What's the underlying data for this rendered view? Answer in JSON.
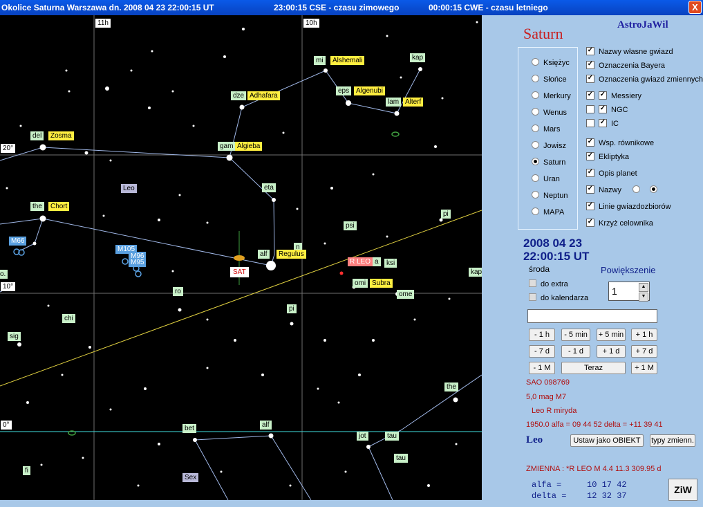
{
  "titlebar": {
    "part1": "Okolice Saturna  Warszawa dn. 2008 04 23    22:00:15 UT",
    "part2": "23:00:15 CSE - czasu zimowego",
    "part3": "00:00:15 CWE - czasu letniego",
    "close": "X"
  },
  "map": {
    "hour_labels": [
      "11h",
      "10h"
    ],
    "dec_labels": [
      "20°",
      "10°",
      "0°"
    ],
    "stars": [
      {
        "text": "mi",
        "style": "g"
      },
      {
        "text": "Alshemali",
        "style": "y"
      },
      {
        "text": "kap",
        "style": "g"
      },
      {
        "text": "dze",
        "style": "g"
      },
      {
        "text": "Adhafara",
        "style": "y"
      },
      {
        "text": "eps",
        "style": "g"
      },
      {
        "text": "Algenubi",
        "style": "y"
      },
      {
        "text": "lam",
        "style": "g"
      },
      {
        "text": "Alterf",
        "style": "y"
      },
      {
        "text": "del",
        "style": "g"
      },
      {
        "text": "Zosma",
        "style": "y"
      },
      {
        "text": "gam",
        "style": "g"
      },
      {
        "text": "Algieba",
        "style": "y"
      },
      {
        "text": "Leo",
        "style": "p"
      },
      {
        "text": "eta",
        "style": "g"
      },
      {
        "text": "the",
        "style": "g"
      },
      {
        "text": "Chort",
        "style": "y"
      },
      {
        "text": "pi",
        "style": "g"
      },
      {
        "text": "psi",
        "style": "g"
      },
      {
        "text": "M66",
        "style": "b"
      },
      {
        "text": "M105",
        "style": "b"
      },
      {
        "text": "M96",
        "style": "b"
      },
      {
        "text": "M95",
        "style": "b"
      },
      {
        "text": "n",
        "style": "g"
      },
      {
        "text": "alf",
        "style": "g"
      },
      {
        "text": "Regulus",
        "style": "y"
      },
      {
        "text": "SAT",
        "style": "sat"
      },
      {
        "text": "R LEO",
        "style": "r"
      },
      {
        "text": "a",
        "style": "g"
      },
      {
        "text": "ksi",
        "style": "g"
      },
      {
        "text": "kap",
        "style": "g"
      },
      {
        "text": "o.",
        "style": "g"
      },
      {
        "text": "ro",
        "style": "g"
      },
      {
        "text": "omi",
        "style": "g"
      },
      {
        "text": "Subra",
        "style": "y"
      },
      {
        "text": "ome",
        "style": "g"
      },
      {
        "text": "pi",
        "style": "g"
      },
      {
        "text": "chi",
        "style": "g"
      },
      {
        "text": "sig",
        "style": "g"
      },
      {
        "text": "the",
        "style": "g"
      },
      {
        "text": "bet",
        "style": "g"
      },
      {
        "text": "alf",
        "style": "g"
      },
      {
        "text": "jot",
        "style": "g"
      },
      {
        "text": "tau",
        "style": "g"
      },
      {
        "text": "tau",
        "style": "g"
      },
      {
        "text": "fi",
        "style": "g"
      },
      {
        "text": "Sex",
        "style": "p"
      }
    ]
  },
  "panel": {
    "planet_name": "Saturn",
    "brand": "AstroJaWil",
    "planets": [
      {
        "label": "Księżyc",
        "selected": false
      },
      {
        "label": "Słońce",
        "selected": false
      },
      {
        "label": "Merkury",
        "selected": false
      },
      {
        "label": "Wenus",
        "selected": false
      },
      {
        "label": "Mars",
        "selected": false
      },
      {
        "label": "Jowisz",
        "selected": false
      },
      {
        "label": "Saturn",
        "selected": true
      },
      {
        "label": "Uran",
        "selected": false
      },
      {
        "label": "Neptun",
        "selected": false
      },
      {
        "label": "MAPA",
        "selected": false
      }
    ],
    "options": [
      {
        "label": "Nazwy własne gwiazd",
        "checked": true
      },
      {
        "label": "Oznaczenia Bayera",
        "checked": true
      },
      {
        "label": "Oznaczenia gwiazd zmiennych",
        "checked": true
      },
      {
        "label": "Messiery",
        "checked": true
      },
      {
        "label": "NGC",
        "checked": true
      },
      {
        "label": "IC",
        "checked": true
      },
      {
        "label": "Wsp. równikowe",
        "checked": true
      },
      {
        "label": "Ekliptyka",
        "checked": true
      },
      {
        "label": "Opis planet",
        "checked": true
      },
      {
        "label": "Nazwy",
        "checked": true
      },
      {
        "label": "Linie gwiazdozbiorów",
        "checked": true
      },
      {
        "label": "Krzyż celownika",
        "checked": true
      }
    ],
    "catalog_outer_checked": [
      true,
      false,
      false
    ],
    "date": "2008 04 23",
    "time": "22:00:15 UT",
    "weekday": "środa",
    "zoom_label": "Powiększenie",
    "extra_label": "do extra",
    "calendar_label": "do kalendarza",
    "zoom_value": "1",
    "search_value": "",
    "buttons": {
      "m1h": "- 1 h",
      "m5min": "- 5 min",
      "p5min": "+ 5 min",
      "p1h": "+ 1 h",
      "m7d": "- 7 d",
      "m1d": "- 1 d",
      "p1d": "+ 1 d",
      "p7d": "+ 7 d",
      "m1M": "- 1 M",
      "now": "Teraz",
      "p1M": "+ 1 M",
      "set_object": "Ustaw jako OBIEKT",
      "var_types": "typy zmienn.",
      "ziw": "ZiW"
    },
    "info": {
      "sao": "SAO 098769",
      "mag": "5,0 mag  M7",
      "type": "Leo   R  miryda",
      "epoch": "1950.0  alfa = 09 44 52   delta = +11 39 41"
    },
    "constellation": "Leo",
    "variable": "ZMIENNA : *R LEO        M        4.4  11.3   309.95 d",
    "coords": {
      "alfa_label": "alfa  =",
      "alfa_value": "10 17 42",
      "delta_label": "delta =",
      "delta_value": "12 32 37"
    }
  },
  "colors": {
    "titlebar": "#0842c0",
    "panel": "#a8c8e8",
    "ecliptic": "#e0d040",
    "equator": "#40e0e0",
    "constellation_lines": "#a0b8e8"
  }
}
